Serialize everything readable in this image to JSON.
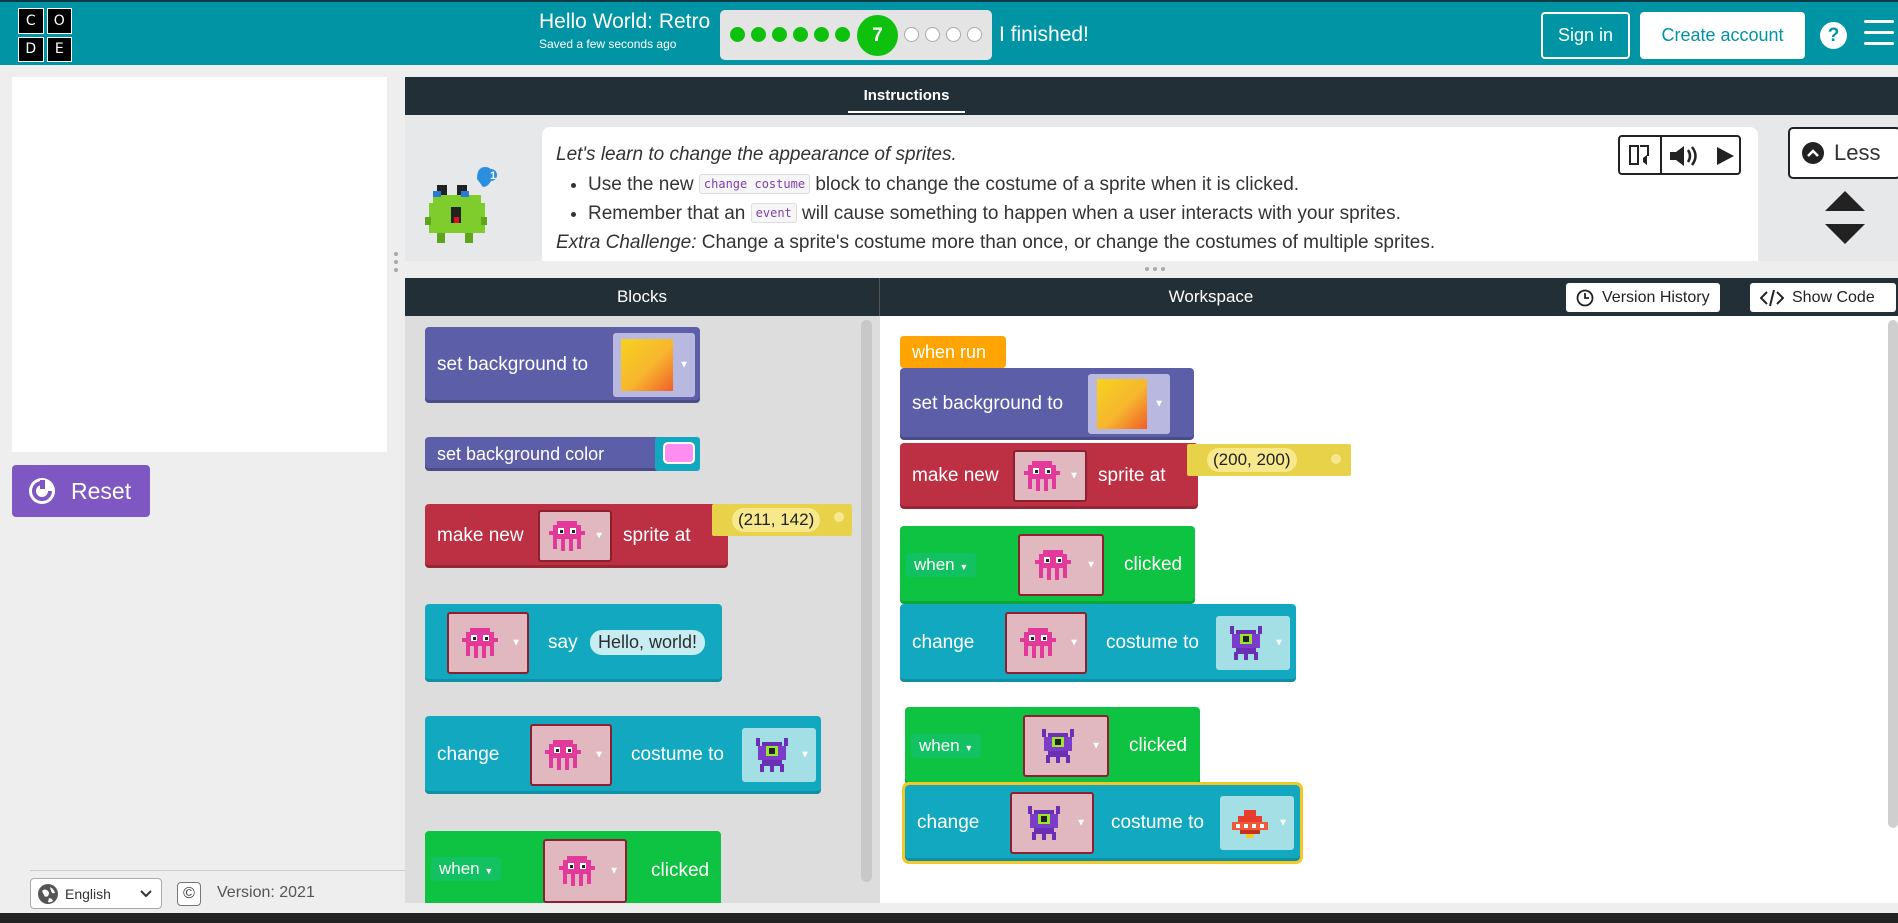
{
  "header": {
    "logo_letters": [
      "C",
      "O",
      "D",
      "E"
    ],
    "project_title": "Hello World: Retro",
    "saved_status": "Saved a few seconds ago",
    "progress": {
      "completed": 6,
      "current_level": "7",
      "remaining": 4
    },
    "finished_label": "I finished!",
    "sign_in_label": "Sign in",
    "create_account_label": "Create account",
    "help_label": "?"
  },
  "left": {
    "reset_label": "Reset",
    "language": "English",
    "copyright_icon": "©",
    "version": "Version: 2021"
  },
  "instructions": {
    "tab_label": "Instructions",
    "hint_badge": "1",
    "lead": "Let's learn to change the appearance of sprites.",
    "bullet1_before": "Use the new",
    "bullet1_code": "change costume",
    "bullet1_after": "block to change the costume of a sprite when it is clicked.",
    "bullet2_before": "Remember that an",
    "bullet2_code": "event",
    "bullet2_after": "will cause something to happen when a user interacts with your sprites.",
    "extra_label": "Extra Challenge:",
    "extra_text": "Change a sprite's costume more than once, or change the costumes of multiple sprites.",
    "less_label": "Less"
  },
  "toolbar": {
    "blocks_label": "Blocks",
    "workspace_label": "Workspace",
    "version_history_label": "Version History",
    "show_code_label": "Show Code"
  },
  "toolbox": {
    "set_background_to": "set background to",
    "set_background_color": "set background color",
    "make_new": "make new",
    "sprite_at": "sprite at",
    "coord": "(211, 142)",
    "say": "say",
    "say_text": "Hello, world!",
    "change": "change",
    "costume_to": "costume to",
    "when": "when",
    "clicked": "clicked"
  },
  "workspace": {
    "when_run": "when run",
    "set_background_to": "set background to",
    "make_new": "make new",
    "sprite_at": "sprite at",
    "coord": "(200, 200)",
    "when": "when",
    "clicked": "clicked",
    "change": "change",
    "costume_to": "costume to"
  },
  "colors": {
    "header": "#0094a4",
    "events_green": "#0ec242",
    "sprites_red": "#bd3044",
    "actions_teal": "#12a9c0",
    "world_purple": "#5c5fa8",
    "reset_purple": "#7e57c2"
  },
  "icons": {
    "reset": "reset-icon",
    "globe": "globe-icon",
    "clock": "clock-icon",
    "code": "code-icon",
    "sprite_pink": "pink-robot-sprite",
    "sprite_purple": "purple-alien-sprite",
    "sprite_ufo": "red-ufo-sprite"
  }
}
